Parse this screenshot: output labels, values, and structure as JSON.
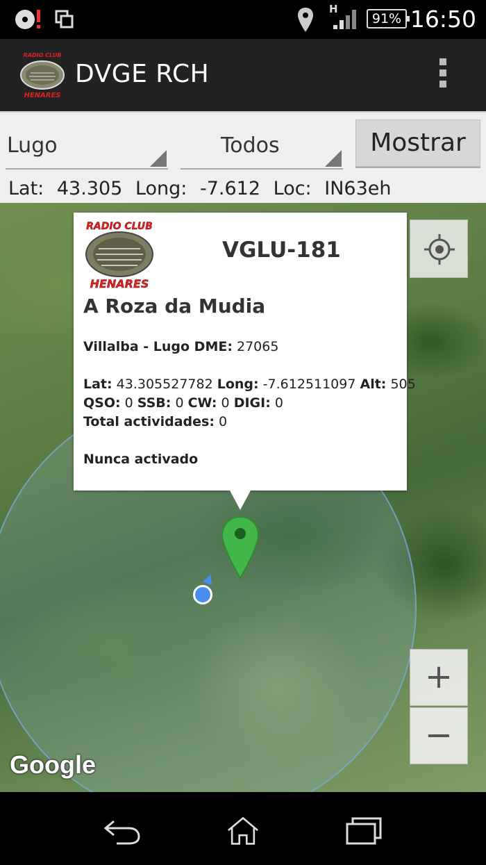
{
  "status_bar": {
    "time": "16:50",
    "battery": "91%",
    "network": "H",
    "icons": [
      "disc-alert-icon",
      "screen-rotate-icon",
      "location-pin-icon",
      "signal-icon",
      "battery-icon"
    ]
  },
  "action_bar": {
    "title": "DVGE RCH",
    "logo": {
      "top_text": "RADIO CLUB",
      "bottom_text": "HENARES"
    },
    "overflow_icon": "overflow-menu-icon"
  },
  "controls": {
    "province_spinner": "Lugo",
    "filter_spinner": "Todos",
    "show_button": "Mostrar",
    "lat_label": "Lat:",
    "lat_value": "43.305",
    "long_label": "Long:",
    "long_value": "-7.612",
    "loc_label": "Loc:",
    "loc_value": "IN63eh"
  },
  "map": {
    "attribution": "Google",
    "zoom_in": "+",
    "zoom_out": "−",
    "my_location_icon": "crosshair-icon",
    "colors": {
      "marker": "#43b649",
      "my_location": "#4a8cf0"
    }
  },
  "info_window": {
    "logo": {
      "top_text": "RADIO CLUB",
      "bottom_text": "HENARES"
    },
    "code": "VGLU-181",
    "name": "A Roza da Mudia",
    "place_label": "Villalba - Lugo DME:",
    "dme_value": "27065",
    "lat_label": "Lat:",
    "lat_value": "43.305527782",
    "long_label": "Long:",
    "long_value": "-7.612511097",
    "alt_label": "Alt:",
    "alt_value": "505",
    "qso_label": "QSO:",
    "qso_value": "0",
    "ssb_label": "SSB:",
    "ssb_value": "0",
    "cw_label": "CW:",
    "cw_value": "0",
    "digi_label": "DIGI:",
    "digi_value": "0",
    "total_label": "Total actividades:",
    "total_value": "0",
    "status": "Nunca activado"
  },
  "nav_bar": {
    "icons": [
      "back-icon",
      "home-icon",
      "recent-apps-icon"
    ]
  }
}
